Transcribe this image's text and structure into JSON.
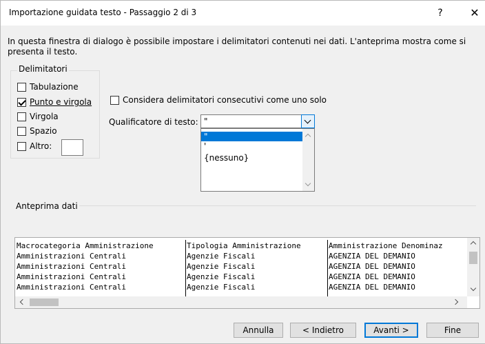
{
  "window": {
    "title": "Importazione guidata testo - Passaggio 2 di 3",
    "help_label": "?",
    "close_label": "✕"
  },
  "description": "In questa finestra di dialogo è possibile impostare i delimitatori contenuti nei dati. L'anteprima mostra come si presenta il testo.",
  "delimiters": {
    "group_label": "Delimitatori",
    "items": [
      {
        "label": "Tabulazione",
        "checked": false
      },
      {
        "label": "Punto e virgola",
        "checked": true
      },
      {
        "label": "Virgola",
        "checked": false
      },
      {
        "label": "Spazio",
        "checked": false
      },
      {
        "label": "Altro:",
        "checked": false
      }
    ]
  },
  "consecutive": {
    "label": "Considera delimitatori consecutivi come uno solo",
    "checked": false
  },
  "qualifier": {
    "label": "Qualificatore di testo:",
    "value": "\"",
    "options": [
      "\"",
      "'",
      "{nessuno}"
    ]
  },
  "preview": {
    "label": "Anteprima dati",
    "columns": [
      "Macrocategoria Amministrazione",
      "Tipologia Amministrazione",
      "Amministrazione Denominaz"
    ],
    "rows": [
      [
        "Amministrazioni Centrali",
        "Agenzie Fiscali",
        "AGENZIA DEL DEMANIO"
      ],
      [
        "Amministrazioni Centrali",
        "Agenzie Fiscali",
        "AGENZIA DEL DEMANIO"
      ],
      [
        "Amministrazioni Centrali",
        "Agenzie Fiscali",
        "AGENZIA DEL DEMANIO"
      ],
      [
        "Amministrazioni Centrali",
        "Agenzie Fiscali",
        "AGENZIA DEL DEMANIO"
      ]
    ]
  },
  "buttons": {
    "cancel": "Annulla",
    "back": "< Indietro",
    "next": "Avanti >",
    "finish": "Fine"
  }
}
